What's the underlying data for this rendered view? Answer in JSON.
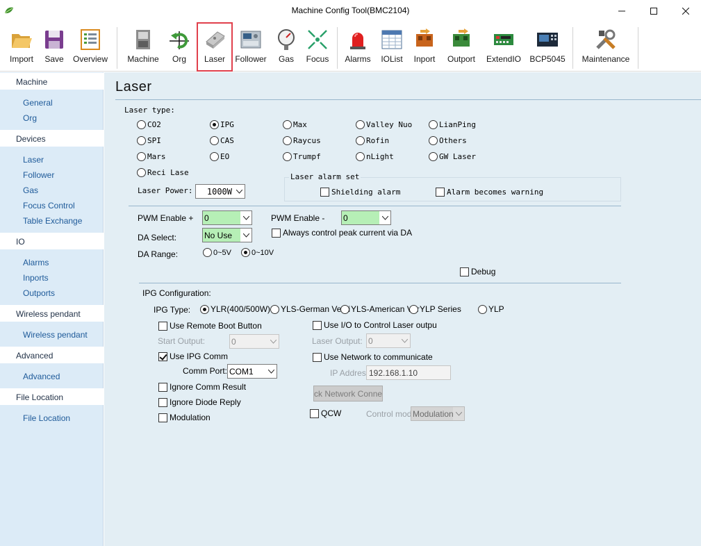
{
  "window": {
    "title": "Machine Config Tool(BMC2104)"
  },
  "toolbar": [
    {
      "label": "Import",
      "icon": "folder-open-icon"
    },
    {
      "label": "Save",
      "icon": "floppy-disk-icon"
    },
    {
      "label": "Overview",
      "icon": "list-document-icon"
    },
    {
      "label": "Machine",
      "icon": "machine-icon"
    },
    {
      "label": "Org",
      "icon": "origin-arrow-icon"
    },
    {
      "label": "Laser",
      "icon": "laser-head-icon",
      "selected": true
    },
    {
      "label": "Follower",
      "icon": "follower-controller-icon"
    },
    {
      "label": "Gas",
      "icon": "pressure-gauge-icon"
    },
    {
      "label": "Focus",
      "icon": "focus-arrows-icon"
    },
    {
      "label": "Alarms",
      "icon": "alarm-beacon-icon"
    },
    {
      "label": "IOList",
      "icon": "table-list-icon"
    },
    {
      "label": "Inport",
      "icon": "inport-connector-icon"
    },
    {
      "label": "Outport",
      "icon": "outport-connector-icon"
    },
    {
      "label": "ExtendIO",
      "icon": "circuit-board-icon"
    },
    {
      "label": "BCP5045",
      "icon": "control-panel-icon"
    },
    {
      "label": "Maintenance",
      "icon": "tools-icon"
    }
  ],
  "sidebar": {
    "sections": [
      {
        "header": "Machine",
        "items": [
          "General",
          "Org"
        ]
      },
      {
        "header": "Devices",
        "items": [
          "Laser",
          "Follower",
          "Gas",
          "Focus Control",
          "Table Exchange"
        ]
      },
      {
        "header": "IO",
        "items": [
          "Alarms",
          "Inports",
          "Outports"
        ]
      },
      {
        "header": "Wireless pendant",
        "items": [
          "Wireless pendant"
        ]
      },
      {
        "header": "Advanced",
        "items": [
          "Advanced"
        ]
      },
      {
        "header": "File Location",
        "items": [
          "File Location"
        ]
      }
    ]
  },
  "page": {
    "title": "Laser",
    "laser_type_label": "Laser type:",
    "laser_types": [
      "CO2",
      "IPG",
      "Max",
      "Valley Nuo",
      "LianPing",
      "SPI",
      "CAS",
      "Raycus",
      "Rofin",
      "Others",
      "Mars",
      "EO",
      "Trumpf",
      "nLight",
      "GW Laser",
      "Reci Lase"
    ],
    "laser_type_selected": "IPG",
    "laser_power_label": "Laser Power:",
    "laser_power_value": "1000W",
    "alarm_set": {
      "title": "Laser alarm set",
      "shielding_alarm": "Shielding alarm",
      "alarm_becomes_warning": "Alarm becomes warning"
    },
    "pwm_enable_plus_label": "PWM Enable +",
    "pwm_enable_plus_value": "0",
    "pwm_enable_minus_label": "PWM Enable -",
    "pwm_enable_minus_value": "0",
    "da_select_label": "DA Select:",
    "da_select_value": "No Use",
    "always_control_peak": "Always control peak current via DA",
    "da_range_label": "DA Range:",
    "da_range_options": [
      "0~5V",
      "0~10V"
    ],
    "da_range_selected": "0~10V",
    "debug_label": "Debug",
    "ipg": {
      "section_label": "IPG Configuration:",
      "type_label": "IPG Type:",
      "types": [
        "YLR(400/500W)",
        "YLS-German Versi",
        "YLS-American Ver",
        "YLP Series",
        "YLP"
      ],
      "type_selected": "YLR(400/500W)",
      "use_remote_boot": "Use Remote Boot Button",
      "start_output_label": "Start Output:",
      "start_output_value": "0",
      "use_ipg_comm": "Use IPG Comm",
      "comm_port_label": "Comm Port:",
      "comm_port_value": "COM1",
      "ignore_comm_result": "Ignore Comm Result",
      "ignore_diode_reply": "Ignore Diode Reply",
      "modulation": "Modulation",
      "use_io_control": "Use I/O to Control Laser outpu",
      "laser_output_label": "Laser Output:",
      "laser_output_value": "0",
      "use_network": "Use Network to communicate",
      "ip_address_label": "IP Address",
      "ip_address_value": "192.168.1.10",
      "check_network_button": "ck Network Connect",
      "qcw_label": "QCW",
      "control_mode_label": "Control mode",
      "control_mode_value": "Modulation"
    }
  },
  "colors": {
    "highlight_outline": "#e0404c",
    "sidebar_bg": "#dcebf7",
    "content_bg": "#e3eef4",
    "green_field": "#b6efb6"
  }
}
